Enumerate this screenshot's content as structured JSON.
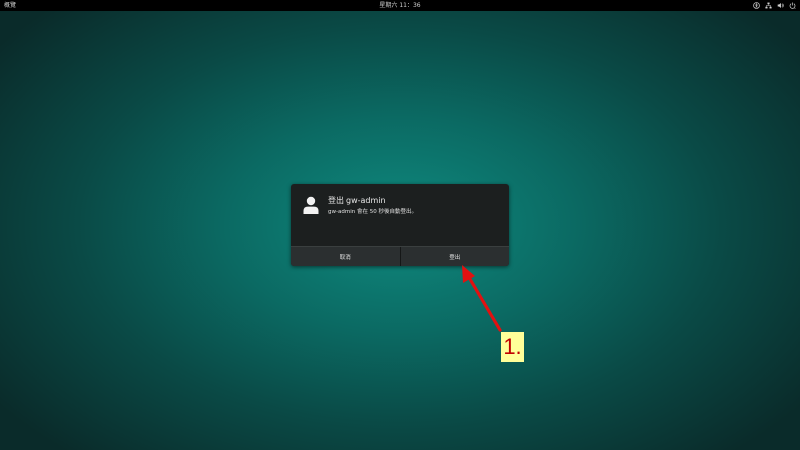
{
  "topbar": {
    "activities_label": "概覽",
    "clock": "星期六 11：36",
    "tray_icons": [
      "accessibility-icon",
      "network-icon",
      "volume-icon",
      "power-icon"
    ]
  },
  "dialog": {
    "title_prefix": "登出",
    "title_user": "gw-admin",
    "message": "gw-admin 會在 50 秒後自動登出。",
    "buttons": {
      "cancel": "取消",
      "logout": "登出"
    },
    "avatar_icon": "user-avatar-icon"
  },
  "annotation": {
    "label": "1.",
    "color": "#e11111",
    "label_background": "#ffff99"
  },
  "colors": {
    "desktop_center": "#0f8a7f",
    "desktop_edge": "#0a2b2a",
    "dialog_bg": "#1c1f1f",
    "button_bg": "#2b2f30"
  }
}
